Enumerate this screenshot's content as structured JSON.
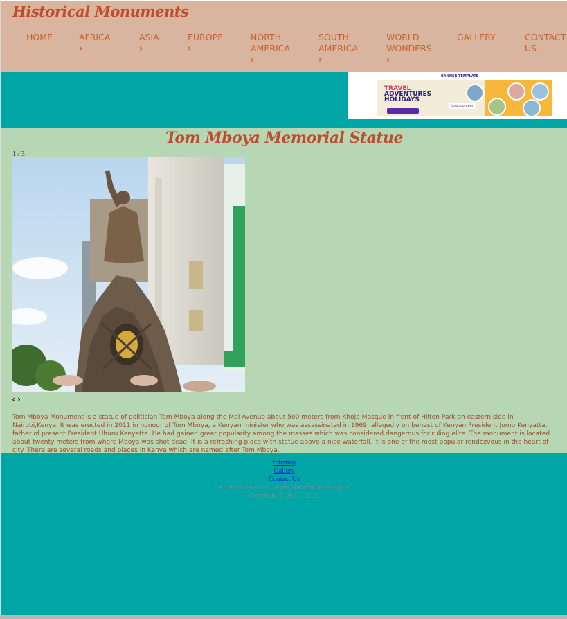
{
  "site": {
    "title": "Historical Monuments"
  },
  "nav": [
    {
      "label": "HOME",
      "has_submenu": false
    },
    {
      "label": "AFRICA",
      "has_submenu": true
    },
    {
      "label": "ASIA",
      "has_submenu": true
    },
    {
      "label": "EUROPE",
      "has_submenu": true
    },
    {
      "label": "NORTH AMERICA",
      "has_submenu": true
    },
    {
      "label": "SOUTH AMERICA",
      "has_submenu": true
    },
    {
      "label": "WORLD WONDERS",
      "has_submenu": true
    },
    {
      "label": "GALLERY",
      "has_submenu": false
    },
    {
      "label": "CONTACT US",
      "has_submenu": false
    }
  ],
  "banner_ad": {
    "header": "BANNER TEMPLATE",
    "line1": "TRAVEL",
    "line2": "ADVENTURES",
    "line3": "HOLIDAYS",
    "tag": "booking open"
  },
  "main": {
    "title": "Tom Mboya Memorial Statue",
    "slideshow": {
      "counter": "1 / 3",
      "prev": "‹",
      "next": "›"
    },
    "description": "Tom Mboya Monument is a statue of politician Tom Mboya along the Moi Avenue about 500 meters from Khoja Mosque in front of Hilton Park on eastern side in Nairobi,Kenya. It was erected in 2011 in honour of Tom Mboya, a Kenyan minister who was assassinated in 1969, allegedly on behest of Kenyan President Jomo Kenyatta, father of present President Uhuru Kenyatta. He had gained great popularity among the masses which was considered dangerous for ruling elite. The monument is located about twenty meters from where Mboya was shot dead. It is a refreshing place with statue above a nice waterfall. It is one of the most popular rendezvous in the heart of city. There are several roads and places in Kenya which are named after Tom Mboya."
  },
  "footer": {
    "links": [
      "Sitemap",
      "Gallery",
      "Contact Us"
    ],
    "rights": "All rights reserved. Terms and conditions apply.",
    "copyright": "Copyright © 2021 - 2021"
  },
  "colors": {
    "header_bg": "#d9b59f",
    "accent": "#c04c2e",
    "nav_text": "#c8612c",
    "page_bg": "#00a6a6",
    "main_bg": "#b7d7b4"
  },
  "icons": {
    "submenu": "chevron-right-icon",
    "prev": "chevron-left-icon",
    "next": "chevron-right-icon"
  }
}
